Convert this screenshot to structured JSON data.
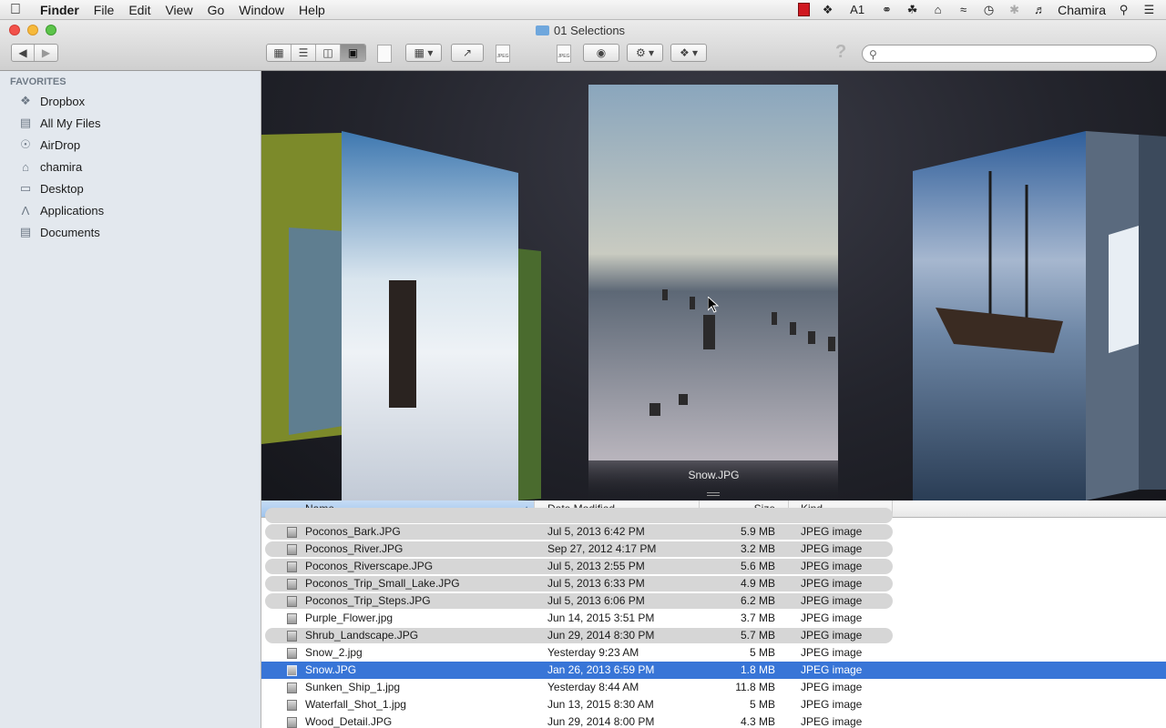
{
  "menubar": {
    "app": "Finder",
    "items": [
      "File",
      "Edit",
      "View",
      "Go",
      "Window",
      "Help"
    ],
    "status": {
      "adobe_badge": "1",
      "user": "Chamira"
    }
  },
  "window": {
    "title": "01 Selections"
  },
  "toolbar": {
    "search_placeholder": "",
    "file_icon_label": "JPEG"
  },
  "sidebar": {
    "heading": "FAVORITES",
    "items": [
      {
        "label": "Dropbox",
        "icon": "dropbox-icon"
      },
      {
        "label": "All My Files",
        "icon": "all-files-icon"
      },
      {
        "label": "AirDrop",
        "icon": "airdrop-icon"
      },
      {
        "label": "chamira",
        "icon": "home-icon"
      },
      {
        "label": "Desktop",
        "icon": "desktop-icon"
      },
      {
        "label": "Applications",
        "icon": "applications-icon"
      },
      {
        "label": "Documents",
        "icon": "documents-icon"
      }
    ]
  },
  "coverflow": {
    "current": "Snow.JPG"
  },
  "list": {
    "columns": {
      "name": "Name",
      "date": "Date Modified",
      "size": "Size",
      "kind": "Kind"
    },
    "rows": [
      {
        "name": "Poconos_Bark.JPG",
        "date": "Jul 5, 2013 6:42 PM",
        "size": "5.9 MB",
        "kind": "JPEG image",
        "style": "grey"
      },
      {
        "name": "Poconos_River.JPG",
        "date": "Sep 27, 2012 4:17 PM",
        "size": "3.2 MB",
        "kind": "JPEG image",
        "style": "grey"
      },
      {
        "name": "Poconos_Riverscape.JPG",
        "date": "Jul 5, 2013 2:55 PM",
        "size": "5.6 MB",
        "kind": "JPEG image",
        "style": "grey"
      },
      {
        "name": "Poconos_Trip_Small_Lake.JPG",
        "date": "Jul 5, 2013 6:33 PM",
        "size": "4.9 MB",
        "kind": "JPEG image",
        "style": "grey"
      },
      {
        "name": "Poconos_Trip_Steps.JPG",
        "date": "Jul 5, 2013 6:06 PM",
        "size": "6.2 MB",
        "kind": "JPEG image",
        "style": "grey"
      },
      {
        "name": "Purple_Flower.jpg",
        "date": "Jun 14, 2015 3:51 PM",
        "size": "3.7 MB",
        "kind": "JPEG image",
        "style": "plain"
      },
      {
        "name": "Shrub_Landscape.JPG",
        "date": "Jun 29, 2014 8:30 PM",
        "size": "5.7 MB",
        "kind": "JPEG image",
        "style": "grey"
      },
      {
        "name": "Snow_2.jpg",
        "date": "Yesterday 9:23 AM",
        "size": "5 MB",
        "kind": "JPEG image",
        "style": "plain"
      },
      {
        "name": "Snow.JPG",
        "date": "Jan 26, 2013 6:59 PM",
        "size": "1.8 MB",
        "kind": "JPEG image",
        "style": "sel"
      },
      {
        "name": "Sunken_Ship_1.jpg",
        "date": "Yesterday 8:44 AM",
        "size": "11.8 MB",
        "kind": "JPEG image",
        "style": "plain"
      },
      {
        "name": "Waterfall_Shot_1.jpg",
        "date": "Jun 13, 2015 8:30 AM",
        "size": "5 MB",
        "kind": "JPEG image",
        "style": "plain"
      },
      {
        "name": "Wood_Detail.JPG",
        "date": "Jun 29, 2014 8:00 PM",
        "size": "4.3 MB",
        "kind": "JPEG image",
        "style": "plain"
      }
    ]
  }
}
